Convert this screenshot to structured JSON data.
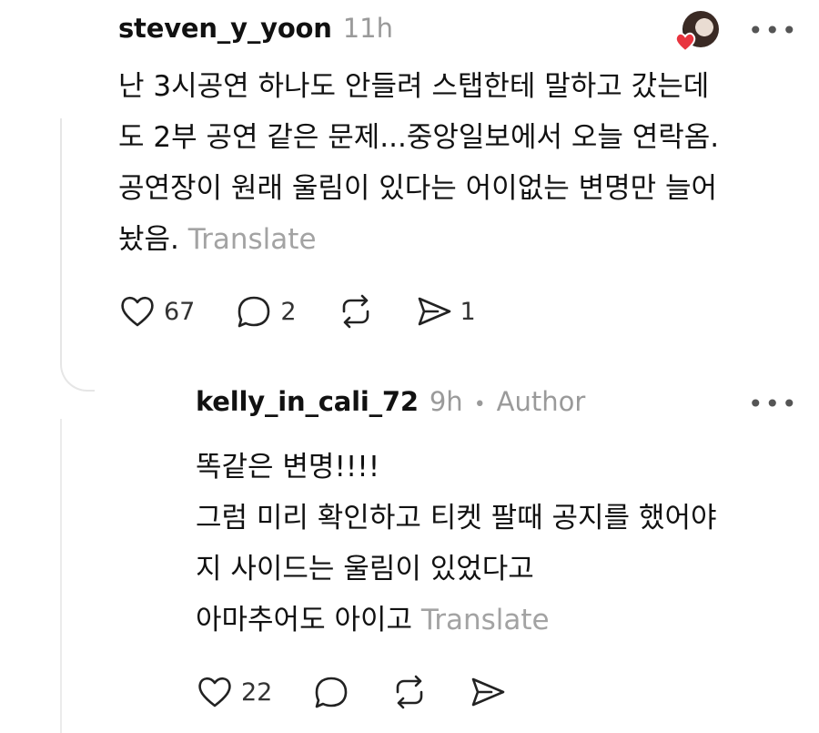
{
  "comment": {
    "username": "steven_y_yoon",
    "time": "11h",
    "lines": [
      "난 3시공연 하나도 안들려 스탭한테 말하고 갔는데",
      "도 2부 공연 같은 문제...중앙일보에서 오늘 연락옴.",
      "공연장이 원래 울림이 있다는 어이없는 변명만 늘어",
      "놨음."
    ],
    "translate": "Translate",
    "likes": "67",
    "replies": "2",
    "shares": "1"
  },
  "reply": {
    "username": "kelly_in_cali_72",
    "time": "9h",
    "separator": "•",
    "badge": "Author",
    "lines": [
      "똑같은 변명!!!!",
      "그럼 미리 확인하고 티켓 팔때 공지를 했어야",
      "지 사이드는 울림이 있었다고",
      "아마추어도 아이고"
    ],
    "translate": "Translate",
    "likes": "22"
  },
  "colors": {
    "text": "#111111",
    "muted": "#9a9a9a",
    "heart_badge": "#e8353f"
  }
}
